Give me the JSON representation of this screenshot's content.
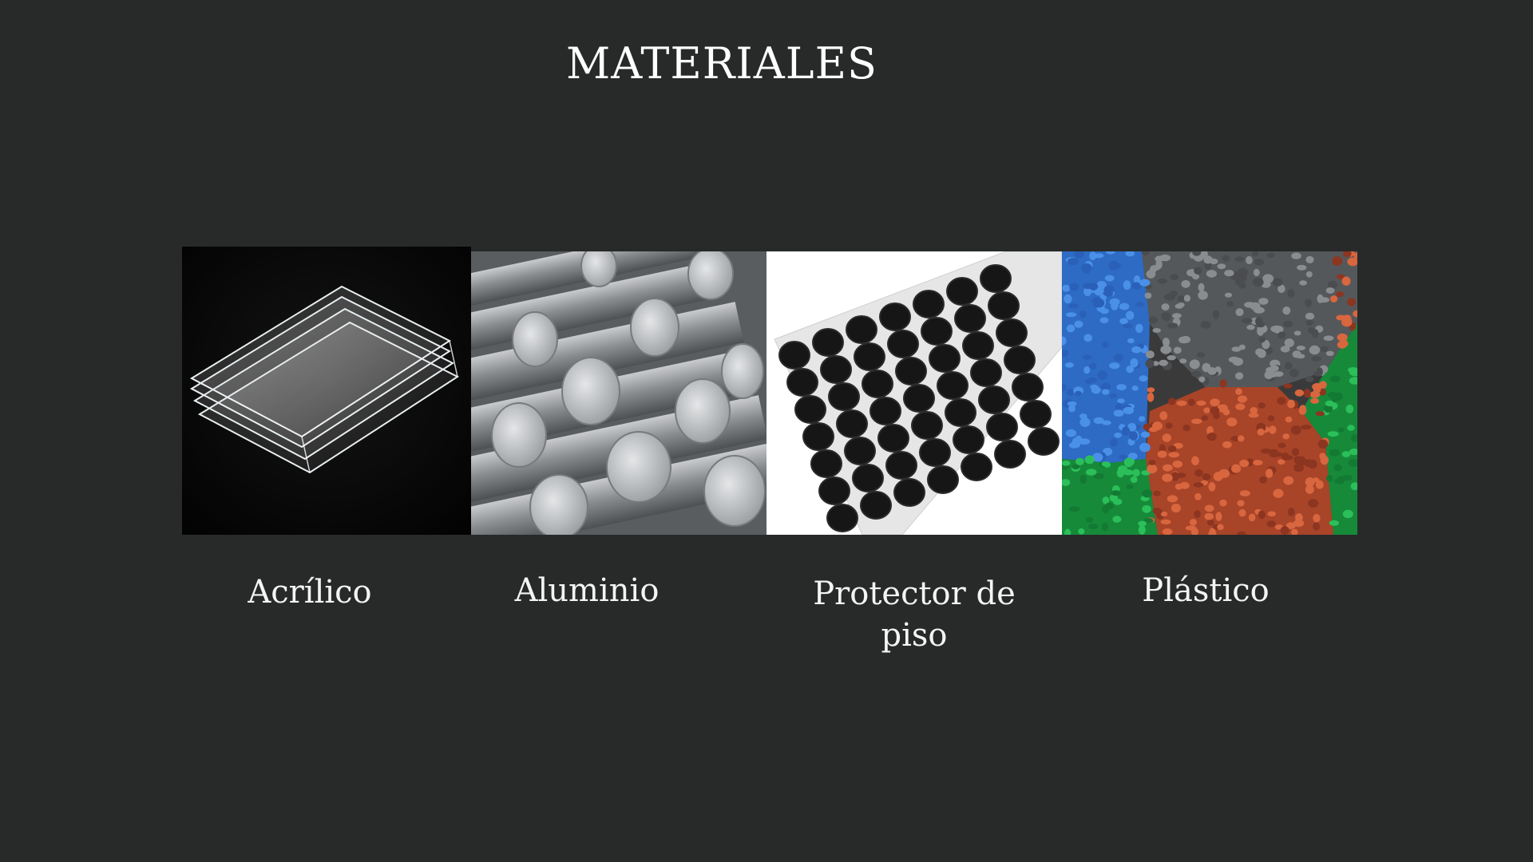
{
  "page": {
    "title": "MATERIALES"
  },
  "materials": [
    {
      "label": "Acrílico",
      "image": "acrylic-sheets-image"
    },
    {
      "label": "Aluminio",
      "image": "aluminum-bars-image"
    },
    {
      "label": "Protector de piso",
      "image": "floor-protector-pads-image"
    },
    {
      "label": "Plástico",
      "image": "plastic-pellets-image"
    }
  ],
  "colors": {
    "background": "#282a2a",
    "text": "#f4f4f4",
    "pellet_blue": "#3b7fd9",
    "pellet_gray": "#6e7072",
    "pellet_orange": "#c85a3a",
    "pellet_green": "#1fa84a"
  }
}
